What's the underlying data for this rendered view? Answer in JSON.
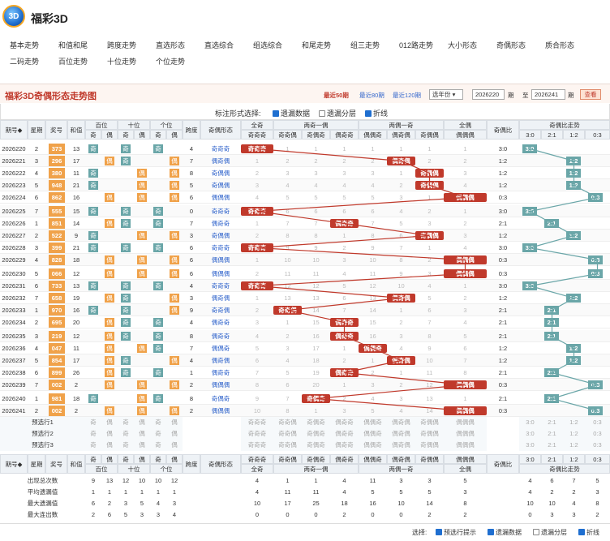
{
  "app": {
    "title": "福彩3D"
  },
  "nav": {
    "row1": [
      "基本走势",
      "和值和尾",
      "跨度走势",
      "直选形态",
      "直选综合",
      "组选综合",
      "和尾走势",
      "组三走势",
      "012路走势",
      "大小形态",
      "奇偶形态",
      "质合形态"
    ],
    "row2": [
      "二码走势",
      "百位走势",
      "十位走势",
      "个位走势"
    ]
  },
  "controls": {
    "title": "福彩3D奇偶形态走势图",
    "p50": "最近50期",
    "p80": "最近80期",
    "p120": "最近120期",
    "year_select": "选年份",
    "from": "2026220",
    "qi1": "期",
    "to_label": "至",
    "to": "2026241",
    "qi2": "期",
    "query": "查看"
  },
  "options": {
    "label": "标注形式选择:",
    "o1": "遗漏数据",
    "o2": "遗漏分层",
    "o3": "折线"
  },
  "headers": {
    "issue": "期号",
    "week": "星期",
    "prize": "奖号",
    "sum": "和值",
    "bai": "百位",
    "shi": "十位",
    "ge": "个位",
    "span": "跨度",
    "shape": "奇偶形态",
    "allodd": "全奇",
    "two_odd_one_even": "两奇一偶",
    "two_even_one_odd": "两偶一奇",
    "alleven": "全偶",
    "ratio": "奇偶比",
    "ratio_trend": "奇偶比走势",
    "odd": "奇",
    "even": "偶",
    "tw_cols": [
      "奇奇偶",
      "奇偶奇",
      "偶奇奇"
    ],
    "te_cols": [
      "偶偶奇",
      "偶奇偶",
      "奇偶偶"
    ],
    "ae_col": "偶偶偶",
    "ao_col": "奇奇奇",
    "trend_cols": [
      "3:0",
      "2:1",
      "1:2",
      "0:3"
    ]
  },
  "rows": [
    {
      "issue": "2026220",
      "week": "2",
      "prize": "373",
      "sum": "13",
      "shape": "奇奇奇",
      "type": 0,
      "ratio": "3:0",
      "rt": 0
    },
    {
      "issue": "2026221",
      "week": "3",
      "prize": "296",
      "sum": "17",
      "shape": "偶奇偶",
      "type": 5,
      "ratio": "1:2",
      "rt": 2
    },
    {
      "issue": "2026222",
      "week": "4",
      "prize": "380",
      "sum": "11",
      "shape": "奇偶偶",
      "type": 6,
      "ratio": "1:2",
      "rt": 2
    },
    {
      "issue": "2026223",
      "week": "5",
      "prize": "948",
      "sum": "21",
      "shape": "奇偶偶",
      "type": 6,
      "ratio": "1:2",
      "rt": 2
    },
    {
      "issue": "2026224",
      "week": "6",
      "prize": "862",
      "sum": "16",
      "shape": "偶偶偶",
      "type": 7,
      "ratio": "0:3",
      "rt": 3
    },
    {
      "issue": "2026225",
      "week": "7",
      "prize": "555",
      "sum": "15",
      "shape": "奇奇奇",
      "type": 0,
      "ratio": "3:0",
      "rt": 0
    },
    {
      "issue": "2026226",
      "week": "1",
      "prize": "851",
      "sum": "14",
      "shape": "偶奇奇",
      "type": 3,
      "ratio": "2:1",
      "rt": 1
    },
    {
      "issue": "2026227",
      "week": "2",
      "prize": "522",
      "sum": "9",
      "shape": "奇偶偶",
      "type": 6,
      "ratio": "1:2",
      "rt": 2
    },
    {
      "issue": "2026228",
      "week": "3",
      "prize": "399",
      "sum": "21",
      "shape": "奇奇奇",
      "type": 0,
      "ratio": "3:0",
      "rt": 0
    },
    {
      "issue": "2026229",
      "week": "4",
      "prize": "828",
      "sum": "18",
      "shape": "偶偶偶",
      "type": 7,
      "ratio": "0:3",
      "rt": 3
    },
    {
      "issue": "2026230",
      "week": "5",
      "prize": "066",
      "sum": "12",
      "shape": "偶偶偶",
      "type": 7,
      "ratio": "0:3",
      "rt": 3
    },
    {
      "issue": "2026231",
      "week": "6",
      "prize": "733",
      "sum": "13",
      "shape": "奇奇奇",
      "type": 0,
      "ratio": "3:0",
      "rt": 0
    },
    {
      "issue": "2026232",
      "week": "7",
      "prize": "658",
      "sum": "19",
      "shape": "偶奇偶",
      "type": 5,
      "ratio": "1:2",
      "rt": 2
    },
    {
      "issue": "2026233",
      "week": "1",
      "prize": "970",
      "sum": "16",
      "shape": "奇奇偶",
      "type": 1,
      "ratio": "2:1",
      "rt": 1
    },
    {
      "issue": "2026234",
      "week": "2",
      "prize": "695",
      "sum": "20",
      "shape": "偶奇奇",
      "type": 3,
      "ratio": "2:1",
      "rt": 1
    },
    {
      "issue": "2026235",
      "week": "3",
      "prize": "219",
      "sum": "12",
      "shape": "偶奇奇",
      "type": 3,
      "ratio": "2:1",
      "rt": 1
    },
    {
      "issue": "2026236",
      "week": "4",
      "prize": "047",
      "sum": "11",
      "shape": "偶偶奇",
      "type": 4,
      "ratio": "1:2",
      "rt": 2
    },
    {
      "issue": "2026237",
      "week": "5",
      "prize": "854",
      "sum": "17",
      "shape": "偶奇偶",
      "type": 5,
      "ratio": "1:2",
      "rt": 2
    },
    {
      "issue": "2026238",
      "week": "6",
      "prize": "899",
      "sum": "26",
      "shape": "偶奇奇",
      "type": 3,
      "ratio": "2:1",
      "rt": 1
    },
    {
      "issue": "2026239",
      "week": "7",
      "prize": "002",
      "sum": "2",
      "shape": "偶偶偶",
      "type": 7,
      "ratio": "0:3",
      "rt": 3
    },
    {
      "issue": "2026240",
      "week": "1",
      "prize": "981",
      "sum": "18",
      "shape": "奇偶奇",
      "type": 2,
      "ratio": "2:1",
      "rt": 1
    },
    {
      "issue": "2026241",
      "week": "2",
      "prize": "002",
      "sum": "2",
      "shape": "偶偶偶",
      "type": 7,
      "ratio": "0:3",
      "rt": 3
    }
  ],
  "pre": [
    "预选行1",
    "预选行2",
    "预选行3"
  ],
  "stats": {
    "labels": [
      "出现总次数",
      "平均遗漏值",
      "最大遗漏值",
      "最大连出数"
    ],
    "digits": [
      [
        "9",
        "13",
        "12",
        "10",
        "10",
        "12"
      ],
      [
        "1",
        "1",
        "1",
        "1",
        "1",
        "1"
      ],
      [
        "6",
        "2",
        "3",
        "5",
        "4",
        "3"
      ],
      [
        "2",
        "6",
        "5",
        "3",
        "3",
        "4"
      ]
    ],
    "types": [
      [
        "4",
        "1",
        "1",
        "4",
        "11",
        "3",
        "3",
        "5"
      ],
      [
        "4",
        "11",
        "11",
        "4",
        "5",
        "5",
        "5",
        "3"
      ],
      [
        "10",
        "17",
        "25",
        "18",
        "16",
        "10",
        "14",
        "8"
      ],
      [
        "0",
        "0",
        "0",
        "2",
        "0",
        "0",
        "2",
        "2"
      ]
    ],
    "trend": [
      [
        "4",
        "6",
        "7",
        "5"
      ],
      [
        "4",
        "2",
        "2",
        "3"
      ],
      [
        "10",
        "10",
        "4",
        "8"
      ],
      [
        "0",
        "3",
        "3",
        "2"
      ]
    ]
  },
  "footer": {
    "label": "选择:",
    "o1": "预选行提示",
    "o2": "遗漏数据",
    "o3": "遗漏分层",
    "o4": "折线"
  },
  "colors": {
    "accent": "#c0392b",
    "teal": "#6aa6a8",
    "prize": "#f0a24a"
  }
}
